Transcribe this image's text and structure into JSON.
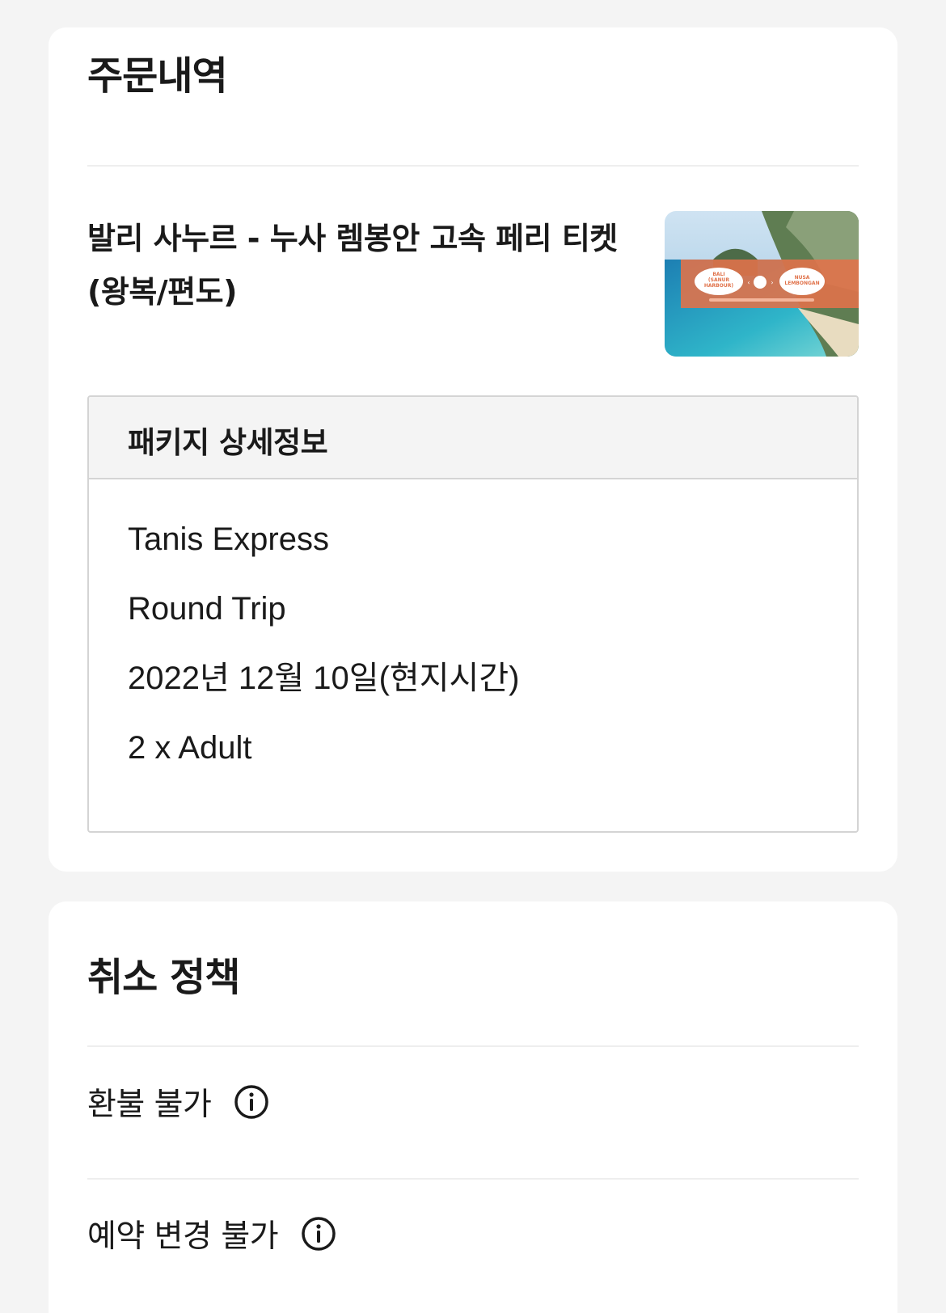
{
  "order": {
    "title": "주문내역",
    "product_title": "발리 사누르 - 누사 렘봉안 고속 페리 티켓 (왕복/편도)",
    "thumbnail": {
      "from_label": "BALI (SANUR HARBOUR)",
      "to_label": "NUSA LEMBONGAN",
      "accent_color": "#e0724a"
    },
    "package": {
      "header": "패키지 상세정보",
      "lines": [
        "Tanis Express",
        "Round Trip",
        "2022년 12월 10일(현지시간)",
        "2 x Adult"
      ]
    }
  },
  "cancellation": {
    "title": "취소 정책",
    "items": [
      {
        "label": "환불 불가",
        "icon": "info-icon"
      },
      {
        "label": "예약 변경 불가",
        "icon": "info-icon"
      }
    ]
  }
}
